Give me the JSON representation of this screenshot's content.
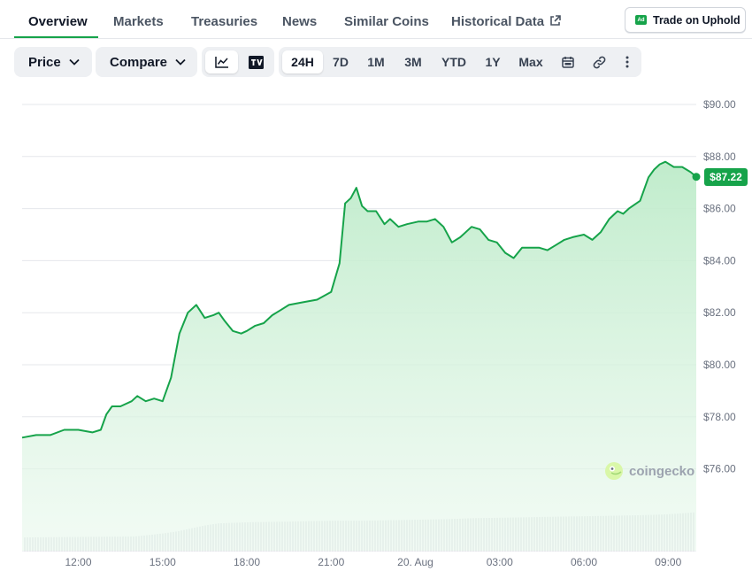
{
  "tabs": {
    "overview": "Overview",
    "markets": "Markets",
    "treasuries": "Treasuries",
    "news": "News",
    "similar": "Similar Coins",
    "historical": "Historical Data"
  },
  "trade_button": {
    "label": "Trade on Uphold",
    "badge": "Ad"
  },
  "toolbar": {
    "price_label": "Price",
    "compare_label": "Compare",
    "ranges": [
      "24H",
      "7D",
      "1M",
      "3M",
      "YTD",
      "1Y",
      "Max"
    ],
    "selected_range": "24H",
    "tradingview_label": "TV"
  },
  "colors": {
    "accent": "#16a34a",
    "line": "#16a34a",
    "area_top": "#bdebc9",
    "grid": "#e5e7eb"
  },
  "icons": [
    "external-link-icon",
    "chevron-down-icon",
    "line-chart-icon",
    "tradingview-icon",
    "calendar-icon",
    "link-icon",
    "more-vertical-icon",
    "coingecko-logo-icon"
  ],
  "watermark": "coingecko",
  "current_price_label": "$87.22",
  "chart_data": {
    "type": "area",
    "title": "",
    "xlabel": "",
    "ylabel": "",
    "ylim": [
      75.0,
      90.0
    ],
    "yticks": [
      "$90.00",
      "$88.00",
      "$86.00",
      "$84.00",
      "$82.00",
      "$80.00",
      "$78.00",
      "$76.00"
    ],
    "ytick_values": [
      90,
      88,
      86,
      84,
      82,
      80,
      78,
      76
    ],
    "xticks": [
      {
        "label": "12:00",
        "t": 2.0
      },
      {
        "label": "15:00",
        "t": 5.0
      },
      {
        "label": "18:00",
        "t": 8.0
      },
      {
        "label": "21:00",
        "t": 11.0
      },
      {
        "label": "20. Aug",
        "t": 14.0
      },
      {
        "label": "03:00",
        "t": 17.0
      },
      {
        "label": "06:00",
        "t": 20.0
      },
      {
        "label": "09:00",
        "t": 23.0
      }
    ],
    "xlim": [
      0.0,
      24.0
    ],
    "grid": true,
    "series": [
      {
        "x": [
          0.0,
          0.5,
          1.0,
          1.5,
          2.0,
          2.5,
          2.8,
          3.0,
          3.2,
          3.5,
          3.9,
          4.1,
          4.4,
          4.7,
          5.0,
          5.3,
          5.6,
          5.9,
          6.2,
          6.5,
          6.8,
          7.0,
          7.2,
          7.5,
          7.8,
          8.0,
          8.3,
          8.6,
          8.9,
          9.2,
          9.5,
          10.0,
          10.5,
          11.0,
          11.3,
          11.5,
          11.7,
          11.9,
          12.1,
          12.3,
          12.6,
          12.9,
          13.1,
          13.4,
          13.7,
          14.1,
          14.4,
          14.7,
          15.0,
          15.3,
          15.6,
          16.0,
          16.3,
          16.6,
          16.9,
          17.2,
          17.5,
          17.8,
          18.1,
          18.4,
          18.7,
          19.0,
          19.3,
          19.6,
          20.0,
          20.3,
          20.6,
          20.9,
          21.2,
          21.4,
          21.6,
          22.0,
          22.3,
          22.5,
          22.7,
          22.9,
          23.2,
          23.5,
          23.8,
          24.0
        ],
        "values": [
          77.2,
          77.3,
          77.3,
          77.5,
          77.5,
          77.4,
          77.5,
          78.1,
          78.4,
          78.4,
          78.6,
          78.8,
          78.6,
          78.7,
          78.6,
          79.5,
          81.2,
          82.0,
          82.3,
          81.8,
          81.9,
          82.0,
          81.7,
          81.3,
          81.2,
          81.3,
          81.5,
          81.6,
          81.9,
          82.1,
          82.3,
          82.4,
          82.5,
          82.8,
          83.9,
          86.2,
          86.4,
          86.8,
          86.1,
          85.9,
          85.9,
          85.4,
          85.6,
          85.3,
          85.4,
          85.5,
          85.5,
          85.6,
          85.3,
          84.7,
          84.9,
          85.3,
          85.2,
          84.8,
          84.7,
          84.3,
          84.1,
          84.5,
          84.5,
          84.5,
          84.4,
          84.6,
          84.8,
          84.9,
          85.0,
          84.8,
          85.1,
          85.6,
          85.9,
          85.8,
          86.0,
          86.3,
          87.2,
          87.5,
          87.7,
          87.8,
          87.6,
          87.6,
          87.4,
          87.22
        ]
      }
    ],
    "volume": {
      "x": [
        0.0,
        2.0,
        4.0,
        4.5,
        5.0,
        5.5,
        6.0,
        6.5,
        7.0,
        8.0,
        9.0,
        10.0,
        11.0,
        12.0,
        13.0,
        14.0,
        15.0,
        16.0,
        17.0,
        18.0,
        19.0,
        20.0,
        21.0,
        22.0,
        23.0,
        24.0
      ],
      "values": [
        0.28,
        0.29,
        0.3,
        0.33,
        0.36,
        0.4,
        0.46,
        0.52,
        0.56,
        0.58,
        0.59,
        0.6,
        0.61,
        0.61,
        0.62,
        0.63,
        0.64,
        0.66,
        0.67,
        0.68,
        0.69,
        0.7,
        0.71,
        0.72,
        0.74,
        0.78
      ]
    }
  }
}
